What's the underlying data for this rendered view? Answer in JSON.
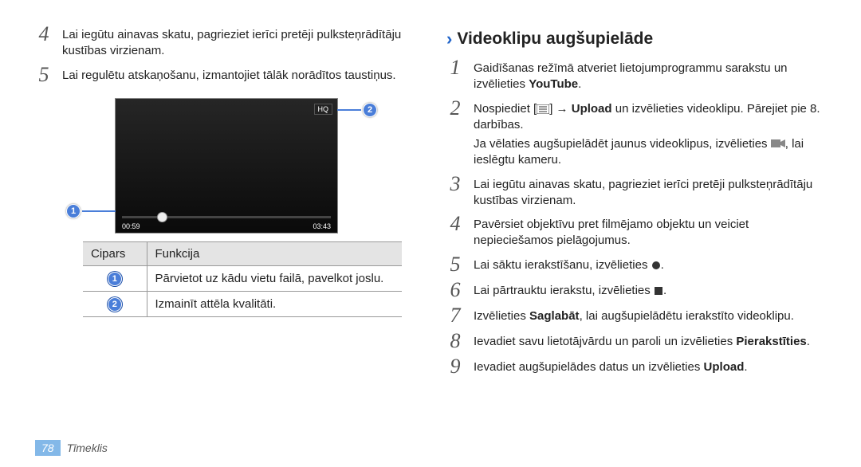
{
  "left": {
    "step4": "Lai iegūtu ainavas skatu, pagrieziet ierīci pretēji pulksteņrādītāju kustības virzienam.",
    "step5": "Lai regulētu atskaņošanu, izmantojiet tālāk norādītos taustiņus.",
    "video": {
      "hq": "HQ",
      "time_left": "00:59",
      "time_right": "03:43"
    },
    "table": {
      "h1": "Cipars",
      "h2": "Funkcija",
      "r1": "Pārvietot uz kādu vietu failā, pavelkot joslu.",
      "r2": "Izmainīt attēla kvalitāti."
    }
  },
  "right": {
    "heading": "Videoklipu augšupielāde",
    "step1a": "Gaidīšanas režīmā atveriet lietojumprogrammu sarakstu un izvēlieties ",
    "step1b": "YouTube",
    "step1c": ".",
    "step2a": "Nospiediet [",
    "step2b": "] → ",
    "step2c": "Upload",
    "step2d": " un izvēlieties videoklipu. Pārejiet pie 8. darbības.",
    "step2sub": "Ja vēlaties augšupielādēt jaunus videoklipus, izvēlieties ",
    "step2sub2": ", lai ieslēgtu kameru.",
    "step3": "Lai iegūtu ainavas skatu, pagrieziet ierīci pretēji pulksteņrādītāju kustības virzienam.",
    "step4": "Pavērsiet objektīvu pret filmējamo objektu un veiciet nepieciešamos pielāgojumus.",
    "step5": "Lai sāktu ierakstīšanu, izvēlieties ",
    "step6": "Lai pārtrauktu ierakstu, izvēlieties ",
    "step7a": "Izvēlieties ",
    "step7b": "Saglabāt",
    "step7c": ", lai augšupielādētu ierakstīto videoklipu.",
    "step8a": "Ievadiet savu lietotājvārdu un paroli un izvēlieties ",
    "step8b": "Pierakstīties",
    "step8c": ".",
    "step9a": "Ievadiet augšupielādes datus un izvēlieties ",
    "step9b": "Upload",
    "step9c": "."
  },
  "footer": {
    "page": "78",
    "label": "Tīmeklis"
  }
}
